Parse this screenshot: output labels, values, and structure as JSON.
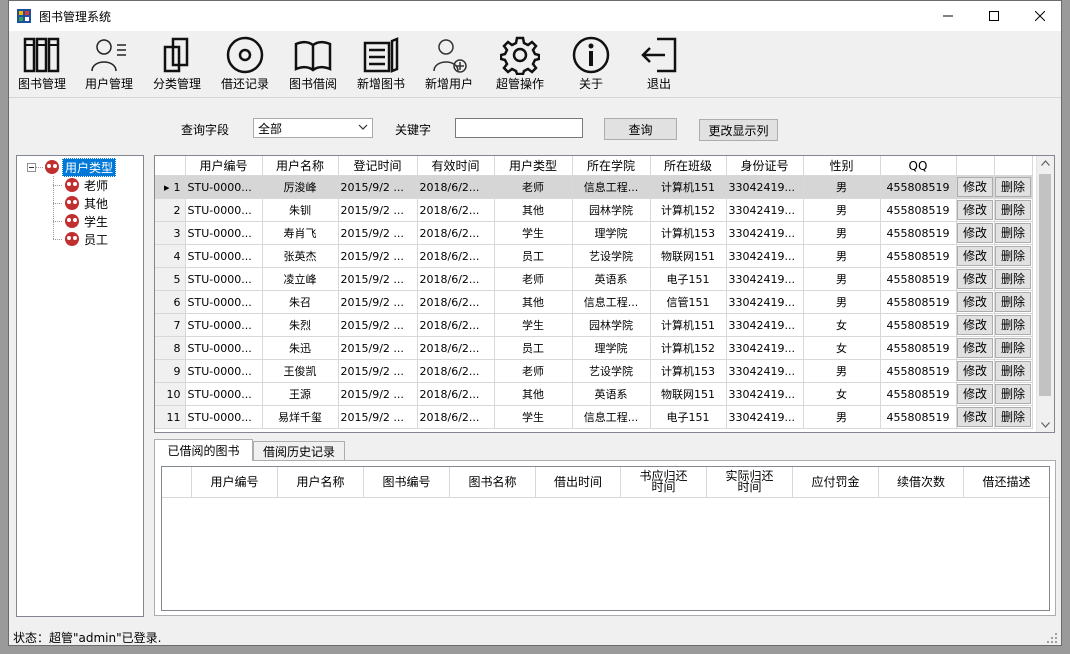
{
  "window": {
    "title": "图书管理系统",
    "colors": {
      "titlebar": "#ffffff",
      "frame": "#f0f0f0",
      "selected_row": "#d6d6d6"
    }
  },
  "toolbar": {
    "items": [
      {
        "label": "图书管理",
        "icon": "books-icon"
      },
      {
        "label": "用户管理",
        "icon": "user-admin-icon"
      },
      {
        "label": "分类管理",
        "icon": "documents-icon"
      },
      {
        "label": "借还记录",
        "icon": "disc-icon"
      },
      {
        "label": "图书借阅",
        "icon": "open-book-icon"
      },
      {
        "label": "新增图书",
        "icon": "add-book-icon"
      },
      {
        "label": "新增用户",
        "icon": "add-user-icon"
      },
      {
        "label": "超管操作",
        "icon": "gear-icon"
      },
      {
        "label": "关于",
        "icon": "info-icon"
      },
      {
        "label": "退出",
        "icon": "exit-icon"
      }
    ]
  },
  "search": {
    "field_label": "查询字段",
    "field_value": "全部",
    "keyword_label": "关键字",
    "keyword_value": "",
    "query_button": "查询",
    "columns_button": "更改显示列"
  },
  "tree": {
    "root": "用户类型",
    "children": [
      "老师",
      "其他",
      "学生",
      "员工"
    ]
  },
  "users_grid": {
    "columns": [
      "用户编号",
      "用户名称",
      "登记时间",
      "有效时间",
      "用户类型",
      "所在学院",
      "所在班级",
      "身份证号",
      "性别",
      "QQ",
      "",
      ""
    ],
    "edit_label": "修改",
    "delete_label": "删除",
    "selected_row": 1,
    "rows": [
      {
        "n": "1",
        "id": "STU-0000...",
        "name": "厉浚峰",
        "reg": "2015/9/2 ...",
        "valid": "2018/6/2...",
        "type": "老师",
        "college": "信息工程...",
        "cls": "计算机151",
        "idno": "33042419...",
        "gender": "男",
        "qq": "455808519"
      },
      {
        "n": "2",
        "id": "STU-0000...",
        "name": "朱钏",
        "reg": "2015/9/2 ...",
        "valid": "2018/6/2...",
        "type": "其他",
        "college": "园林学院",
        "cls": "计算机152",
        "idno": "33042419...",
        "gender": "男",
        "qq": "455808519"
      },
      {
        "n": "3",
        "id": "STU-0000...",
        "name": "寿肖飞",
        "reg": "2015/9/2 ...",
        "valid": "2018/6/2...",
        "type": "学生",
        "college": "理学院",
        "cls": "计算机153",
        "idno": "33042419...",
        "gender": "男",
        "qq": "455808519"
      },
      {
        "n": "4",
        "id": "STU-0000...",
        "name": "张英杰",
        "reg": "2015/9/2 ...",
        "valid": "2018/6/2...",
        "type": "员工",
        "college": "艺设学院",
        "cls": "物联网151",
        "idno": "33042419...",
        "gender": "男",
        "qq": "455808519"
      },
      {
        "n": "5",
        "id": "STU-0000...",
        "name": "凌立峰",
        "reg": "2015/9/2 ...",
        "valid": "2018/6/2...",
        "type": "老师",
        "college": "英语系",
        "cls": "电子151",
        "idno": "33042419...",
        "gender": "男",
        "qq": "455808519"
      },
      {
        "n": "6",
        "id": "STU-0000...",
        "name": "朱召",
        "reg": "2015/9/2 ...",
        "valid": "2018/6/2...",
        "type": "其他",
        "college": "信息工程...",
        "cls": "信管151",
        "idno": "33042419...",
        "gender": "男",
        "qq": "455808519"
      },
      {
        "n": "7",
        "id": "STU-0000...",
        "name": "朱烈",
        "reg": "2015/9/2 ...",
        "valid": "2018/6/2...",
        "type": "学生",
        "college": "园林学院",
        "cls": "计算机151",
        "idno": "33042419...",
        "gender": "女",
        "qq": "455808519"
      },
      {
        "n": "8",
        "id": "STU-0000...",
        "name": "朱迅",
        "reg": "2015/9/2 ...",
        "valid": "2018/6/2...",
        "type": "员工",
        "college": "理学院",
        "cls": "计算机152",
        "idno": "33042419...",
        "gender": "女",
        "qq": "455808519"
      },
      {
        "n": "9",
        "id": "STU-0000...",
        "name": "王俊凯",
        "reg": "2015/9/2 ...",
        "valid": "2018/6/2...",
        "type": "老师",
        "college": "艺设学院",
        "cls": "计算机153",
        "idno": "33042419...",
        "gender": "男",
        "qq": "455808519"
      },
      {
        "n": "10",
        "id": "STU-0000...",
        "name": "王源",
        "reg": "2015/9/2 ...",
        "valid": "2018/6/2...",
        "type": "其他",
        "college": "英语系",
        "cls": "物联网151",
        "idno": "33042419...",
        "gender": "女",
        "qq": "455808519"
      },
      {
        "n": "11",
        "id": "STU-0000...",
        "name": "易烊千玺",
        "reg": "2015/9/2 ...",
        "valid": "2018/6/2...",
        "type": "学生",
        "college": "信息工程...",
        "cls": "电子151",
        "idno": "33042419...",
        "gender": "男",
        "qq": "455808519"
      }
    ]
  },
  "tabs": [
    {
      "label": "已借阅的图书"
    },
    {
      "label": "借阅历史记录"
    }
  ],
  "borrow_grid": {
    "columns": [
      "",
      "用户编号",
      "用户名称",
      "图书编号",
      "图书名称",
      "借出时间",
      "书应归还\n时间",
      "实际归还\n时间",
      "应付罚金",
      "续借次数",
      "借还描述"
    ]
  },
  "status": {
    "text": "状态：超管\"admin\"已登录."
  }
}
